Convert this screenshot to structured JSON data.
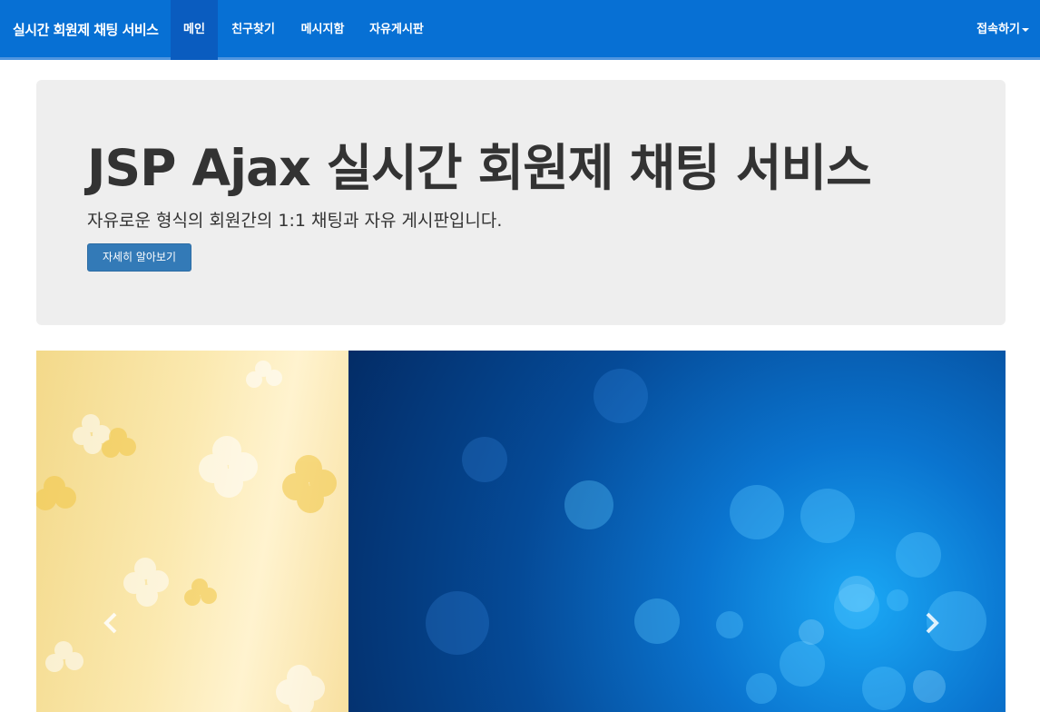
{
  "navbar": {
    "brand": "실시간 회원제 채팅 서비스",
    "items": [
      {
        "label": "메인",
        "active": true
      },
      {
        "label": "친구찾기",
        "active": false
      },
      {
        "label": "메시지함",
        "active": false
      },
      {
        "label": "자유게시판",
        "active": false
      }
    ],
    "right_label": "접속하기"
  },
  "jumbotron": {
    "title": "JSP Ajax 실시간 회원제 채팅 서비스",
    "subtitle": "자유로운 형식의 회원간의 1:1 채팅과 자유 게시판입니다.",
    "button_label": "자세히 알아보기"
  },
  "carousel": {
    "prev_icon": "chevron-left-icon",
    "next_icon": "chevron-right-icon"
  },
  "colors": {
    "navbar_bg": "#0770d4",
    "nav_active_bg": "#0a5cbf",
    "jumbotron_bg": "#eeeeee",
    "primary_button": "#337ab7"
  }
}
